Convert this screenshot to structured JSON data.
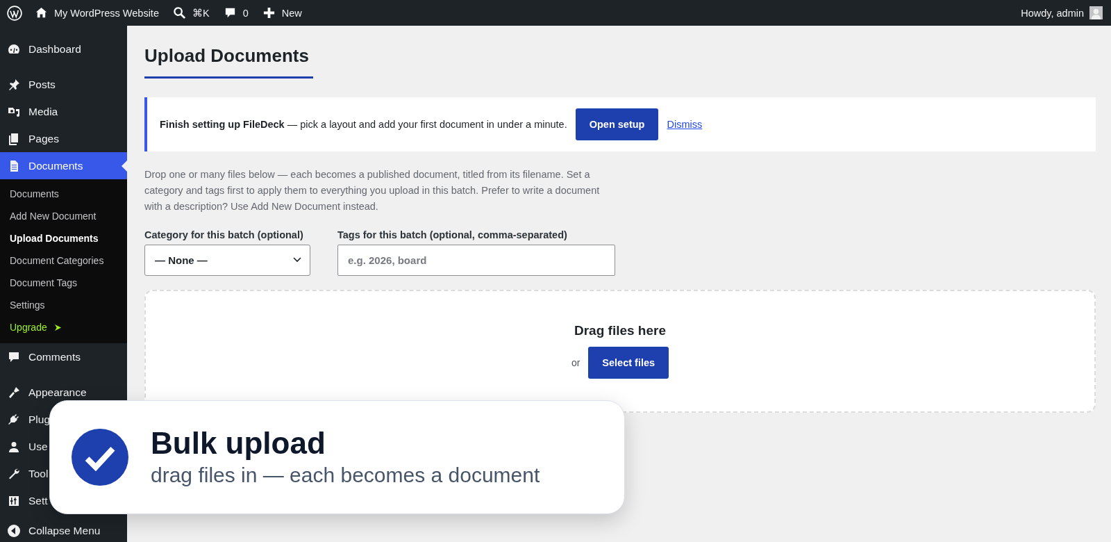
{
  "admin_bar": {
    "site_name": "My WordPress Website",
    "search_shortcut": "⌘K",
    "comments_count": "0",
    "new_label": "New",
    "greeting": "Howdy, admin"
  },
  "sidebar": {
    "groups": [
      {
        "items": [
          {
            "label": "Dashboard",
            "selected": false
          }
        ]
      },
      {
        "items": [
          {
            "label": "Posts",
            "selected": false
          },
          {
            "label": "Media",
            "selected": false
          },
          {
            "label": "Pages",
            "selected": false
          },
          {
            "label": "Documents",
            "selected": true,
            "children": [
              {
                "label": "Documents",
                "selected": false,
                "kind": "link"
              },
              {
                "label": "Add New Document",
                "selected": false,
                "kind": "link"
              },
              {
                "label": "Upload Documents",
                "selected": true,
                "kind": "link"
              },
              {
                "label": "Document Categories",
                "selected": false,
                "kind": "link"
              },
              {
                "label": "Document Tags",
                "selected": false,
                "kind": "link"
              },
              {
                "label": "Settings",
                "selected": false,
                "kind": "link"
              },
              {
                "label": "Upgrade",
                "selected": false,
                "kind": "upgrade"
              }
            ]
          },
          {
            "label": "Comments",
            "selected": false
          }
        ]
      },
      {
        "items": [
          {
            "label": "Appearance",
            "selected": false
          },
          {
            "label": "Plug",
            "selected": false
          },
          {
            "label": "Use",
            "selected": false
          },
          {
            "label": "Tool",
            "selected": false
          },
          {
            "label": "Sett",
            "selected": false
          }
        ]
      }
    ],
    "collapse_label": "Collapse Menu"
  },
  "page_title": "Upload Documents",
  "notice": {
    "text": "**Finish setting up FileDeck** — pick a layout and add your first document in under a minute.",
    "button": "Open setup",
    "link": "Dismiss"
  },
  "description": "Drop one or many files below — each becomes a published document, titled from its filename. Set a category and tags first to apply them to everything you upload in this batch. Prefer to write a document with a description? Use Add New Document instead.",
  "category": {
    "label": "Category for this batch (optional)",
    "value": "— None —"
  },
  "tags": {
    "label": "Tags for this batch (optional, comma-separated)",
    "placeholder": "e.g. 2026, board"
  },
  "dropzone": {
    "title": "Drag files here",
    "or_text": "or",
    "button": "Select files"
  },
  "callout": {
    "title": "Bulk upload",
    "subtitle": "drag files in — each becomes a document"
  }
}
